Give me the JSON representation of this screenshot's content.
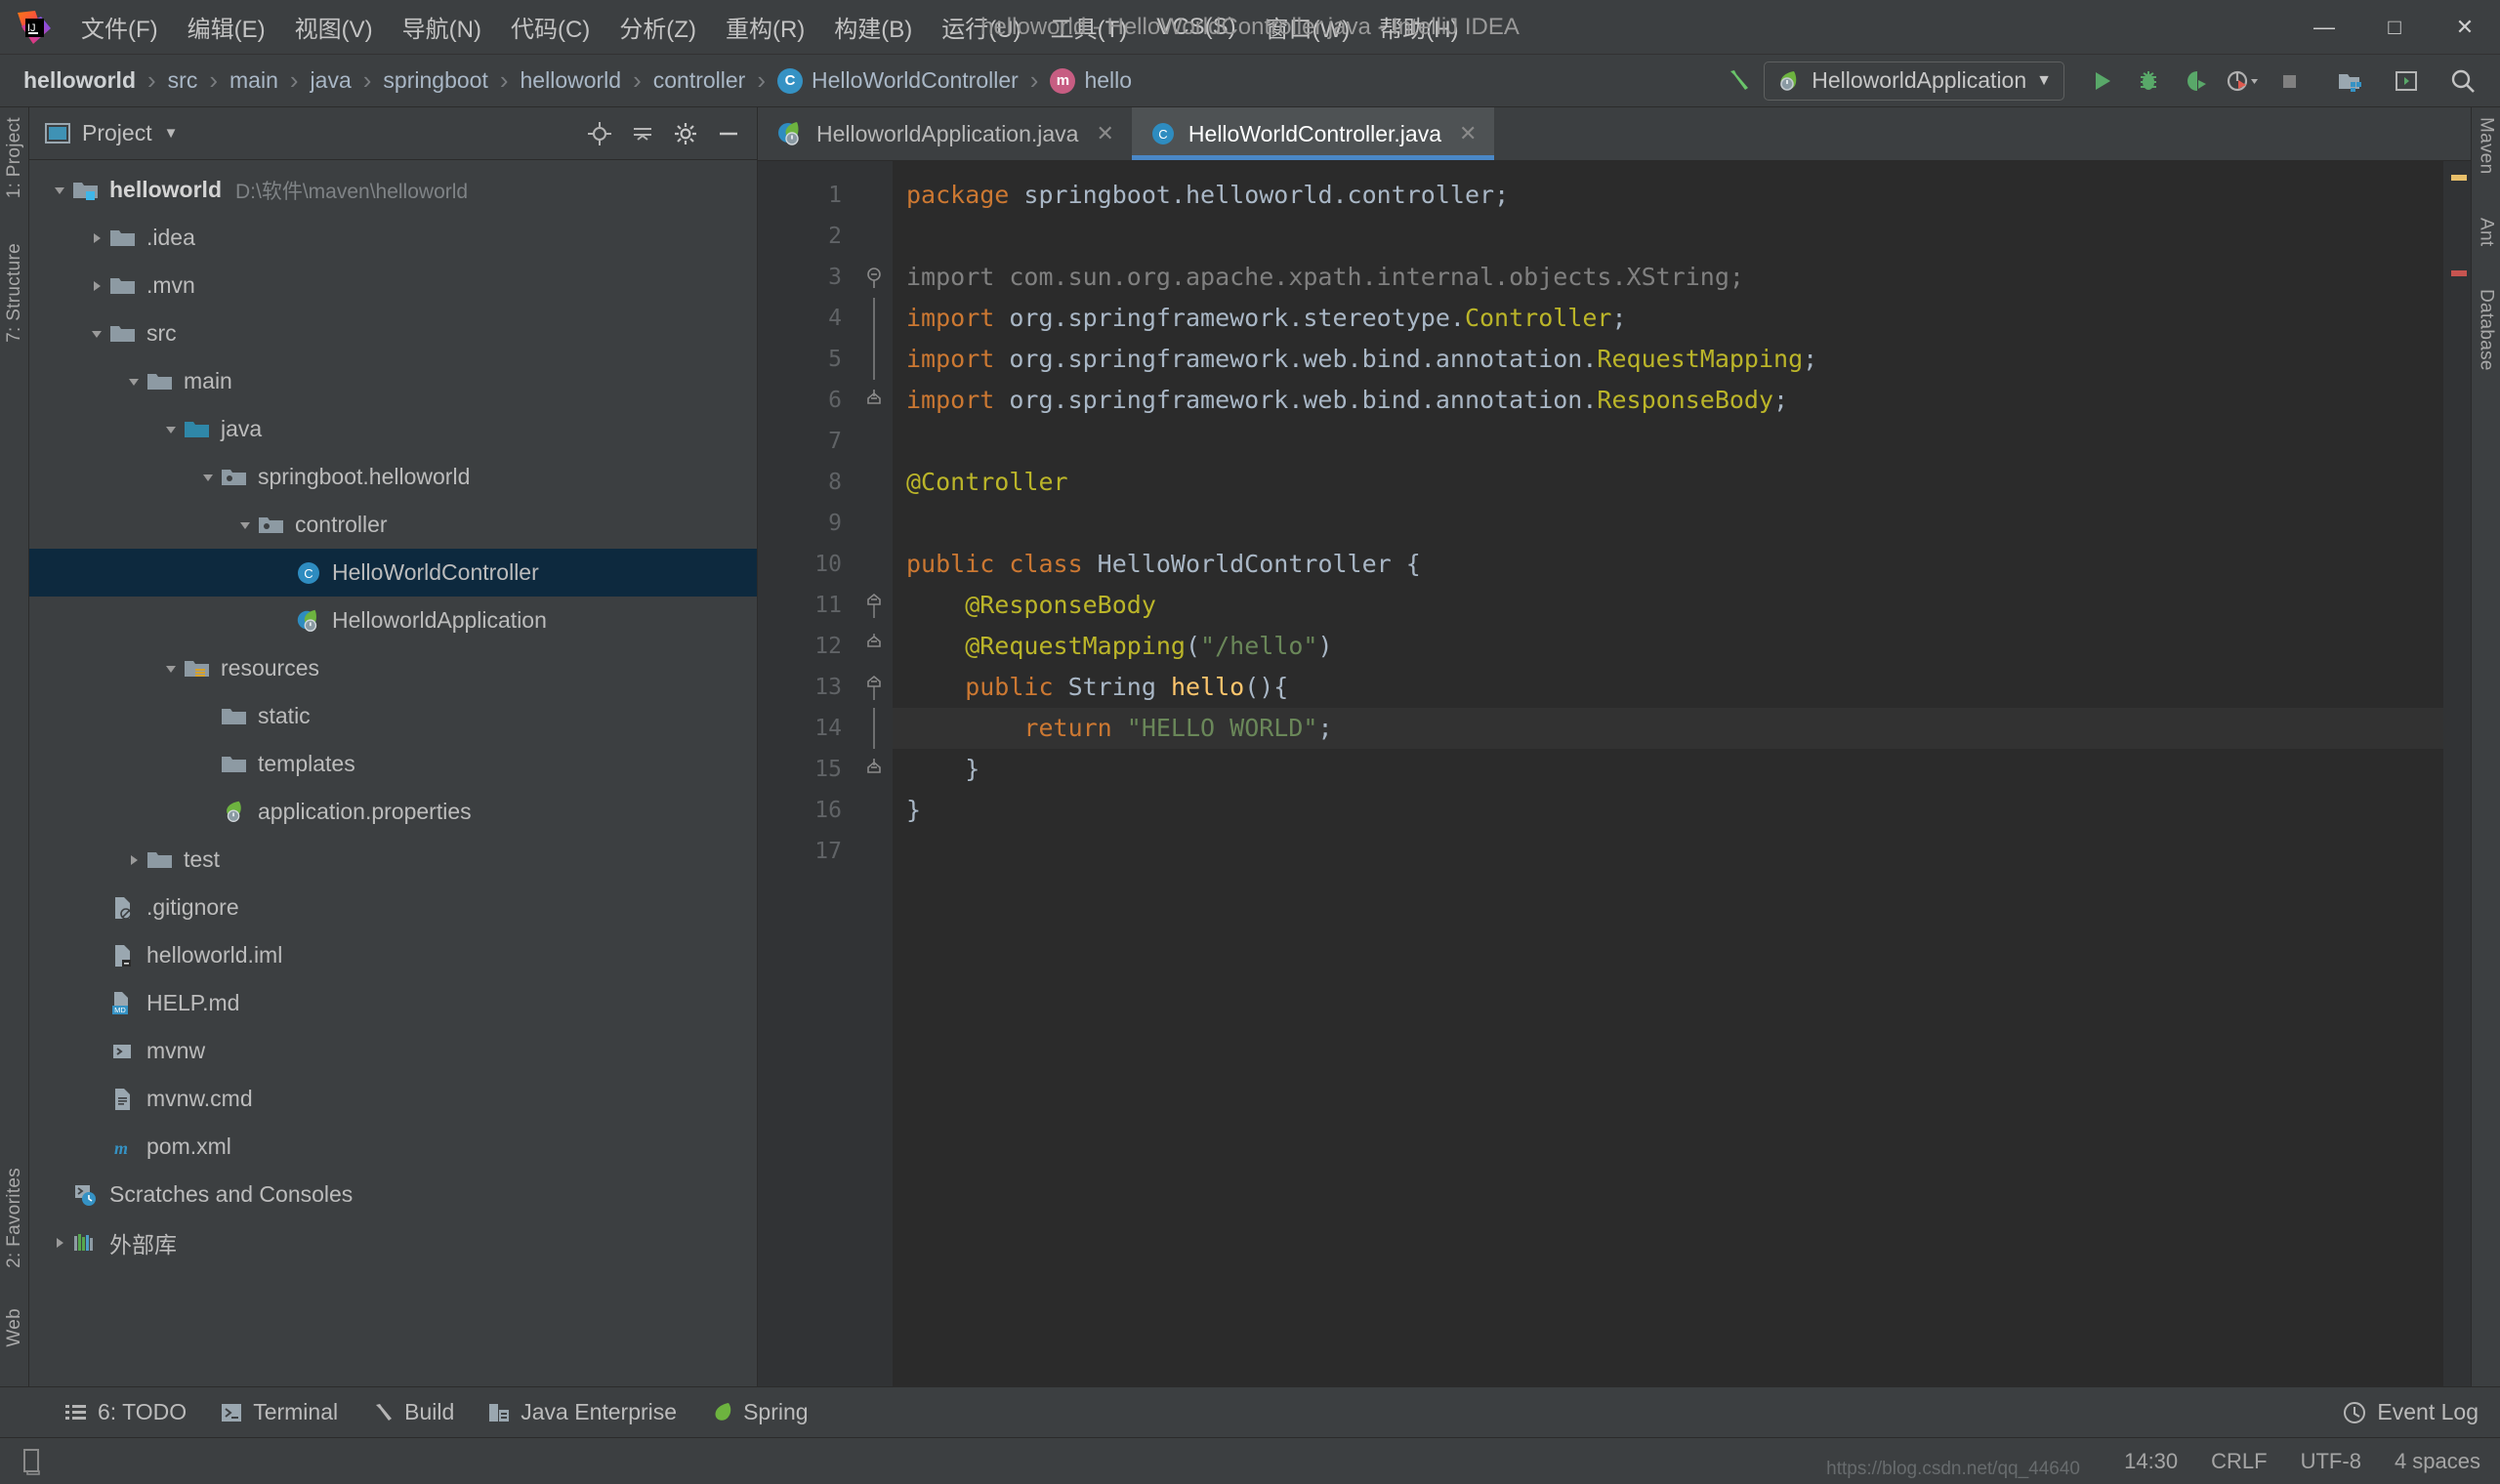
{
  "window": {
    "title": "helloworld - HelloWorldController.java - IntelliJ IDEA",
    "minimize": "—",
    "maximize": "□",
    "close": "✕"
  },
  "menubar": {
    "items": [
      {
        "label": "文件(F)"
      },
      {
        "label": "编辑(E)"
      },
      {
        "label": "视图(V)"
      },
      {
        "label": "导航(N)"
      },
      {
        "label": "代码(C)"
      },
      {
        "label": "分析(Z)"
      },
      {
        "label": "重构(R)"
      },
      {
        "label": "构建(B)"
      },
      {
        "label": "运行(U)"
      },
      {
        "label": "工具(T)"
      },
      {
        "label": "VCS(S)"
      },
      {
        "label": "窗口(W)"
      },
      {
        "label": "帮助(H)"
      }
    ]
  },
  "breadcrumb": {
    "separator": "›",
    "items": [
      {
        "label": "helloworld",
        "icon": "none",
        "bold": true
      },
      {
        "label": "src",
        "icon": "none",
        "bold": false
      },
      {
        "label": "main",
        "icon": "none",
        "bold": false
      },
      {
        "label": "java",
        "icon": "none",
        "bold": false
      },
      {
        "label": "springboot",
        "icon": "none",
        "bold": false
      },
      {
        "label": "helloworld",
        "icon": "none",
        "bold": false
      },
      {
        "label": "controller",
        "icon": "none",
        "bold": false
      },
      {
        "label": "HelloWorldController",
        "icon": "class-icon",
        "badge": "C",
        "bold": false
      },
      {
        "label": "hello",
        "icon": "method-icon",
        "badge": "m",
        "bold": false
      }
    ]
  },
  "toolbar": {
    "run_config": "HelloworldApplication",
    "run_config_dropdown": "▼",
    "buttons": [
      {
        "name": "build-hammer-icon",
        "title": "Build"
      },
      {
        "name": "run-icon",
        "title": "Run"
      },
      {
        "name": "debug-icon",
        "title": "Debug"
      },
      {
        "name": "run-coverage-icon",
        "title": "Run with Coverage"
      },
      {
        "name": "profiler-icon",
        "title": "Profiler"
      },
      {
        "name": "stop-icon",
        "title": "Stop"
      },
      {
        "name": "project-structure-icon",
        "title": "Project Structure"
      },
      {
        "name": "terminal-toggle-icon",
        "title": "Terminal"
      },
      {
        "name": "search-everywhere-icon",
        "title": "Search Everywhere"
      }
    ]
  },
  "left_strip": {
    "tabs": [
      {
        "label": "1: Project",
        "name": "sidebar-tab-project"
      },
      {
        "label": "7: Structure",
        "name": "sidebar-tab-structure"
      },
      {
        "label": "2: Favorites",
        "name": "sidebar-tab-favorites"
      },
      {
        "label": "Web",
        "name": "sidebar-tab-web"
      }
    ]
  },
  "right_strip": {
    "tabs": [
      {
        "label": "Maven",
        "name": "sidebar-tab-maven"
      },
      {
        "label": "Ant",
        "name": "sidebar-tab-ant"
      },
      {
        "label": "Database",
        "name": "sidebar-tab-database"
      }
    ]
  },
  "project_panel": {
    "title": "Project",
    "title_dropdown": "▼",
    "tree": [
      {
        "label": "helloworld",
        "path": "D:\\软件\\maven\\helloworld",
        "indent": 0,
        "twist": "down",
        "icon": "module-folder-icon",
        "bold": true,
        "selected": false
      },
      {
        "label": ".idea",
        "path": "",
        "indent": 1,
        "twist": "right",
        "icon": "folder-icon",
        "bold": false,
        "selected": false
      },
      {
        "label": ".mvn",
        "path": "",
        "indent": 1,
        "twist": "right",
        "icon": "folder-icon",
        "bold": false,
        "selected": false
      },
      {
        "label": "src",
        "path": "",
        "indent": 1,
        "twist": "down",
        "icon": "folder-icon",
        "bold": false,
        "selected": false
      },
      {
        "label": "main",
        "path": "",
        "indent": 2,
        "twist": "down",
        "icon": "folder-icon",
        "bold": false,
        "selected": false
      },
      {
        "label": "java",
        "path": "",
        "indent": 3,
        "twist": "down",
        "icon": "source-folder-icon",
        "bold": false,
        "selected": false
      },
      {
        "label": "springboot.helloworld",
        "path": "",
        "indent": 4,
        "twist": "down",
        "icon": "package-icon",
        "bold": false,
        "selected": false
      },
      {
        "label": "controller",
        "path": "",
        "indent": 5,
        "twist": "down",
        "icon": "package-icon",
        "bold": false,
        "selected": false
      },
      {
        "label": "HelloWorldController",
        "path": "",
        "indent": 6,
        "twist": "none",
        "icon": "java-class-icon",
        "bold": false,
        "selected": true
      },
      {
        "label": "HelloworldApplication",
        "path": "",
        "indent": 6,
        "twist": "none",
        "icon": "spring-boot-class-icon",
        "bold": false,
        "selected": false
      },
      {
        "label": "resources",
        "path": "",
        "indent": 3,
        "twist": "down",
        "icon": "resources-folder-icon",
        "bold": false,
        "selected": false
      },
      {
        "label": "static",
        "path": "",
        "indent": 4,
        "twist": "none",
        "icon": "folder-icon",
        "bold": false,
        "selected": false
      },
      {
        "label": "templates",
        "path": "",
        "indent": 4,
        "twist": "none",
        "icon": "folder-icon",
        "bold": false,
        "selected": false
      },
      {
        "label": "application.properties",
        "path": "",
        "indent": 4,
        "twist": "none",
        "icon": "spring-properties-icon",
        "bold": false,
        "selected": false
      },
      {
        "label": "test",
        "path": "",
        "indent": 2,
        "twist": "right",
        "icon": "folder-icon",
        "bold": false,
        "selected": false
      },
      {
        "label": ".gitignore",
        "path": "",
        "indent": 1,
        "twist": "none",
        "icon": "gitignore-file-icon",
        "bold": false,
        "selected": false
      },
      {
        "label": "helloworld.iml",
        "path": "",
        "indent": 1,
        "twist": "none",
        "icon": "iml-file-icon",
        "bold": false,
        "selected": false
      },
      {
        "label": "HELP.md",
        "path": "",
        "indent": 1,
        "twist": "none",
        "icon": "markdown-file-icon",
        "bold": false,
        "selected": false
      },
      {
        "label": "mvnw",
        "path": "",
        "indent": 1,
        "twist": "none",
        "icon": "shell-script-icon",
        "bold": false,
        "selected": false
      },
      {
        "label": "mvnw.cmd",
        "path": "",
        "indent": 1,
        "twist": "none",
        "icon": "cmd-file-icon",
        "bold": false,
        "selected": false
      },
      {
        "label": "pom.xml",
        "path": "",
        "indent": 1,
        "twist": "none",
        "icon": "maven-pom-icon",
        "bold": false,
        "selected": false
      },
      {
        "label": "Scratches and Consoles",
        "path": "",
        "indent": 0,
        "twist": "none",
        "icon": "scratches-icon",
        "bold": false,
        "selected": false
      },
      {
        "label": "外部库",
        "path": "",
        "indent": 0,
        "twist": "right",
        "icon": "external-libraries-icon",
        "bold": false,
        "selected": false
      }
    ]
  },
  "editor": {
    "tabs": [
      {
        "label": "HelloworldApplication.java",
        "icon": "spring-boot-class-icon",
        "active": false,
        "close": "✕"
      },
      {
        "label": "HelloWorldController.java",
        "icon": "java-class-icon",
        "active": true,
        "close": "✕"
      }
    ],
    "line_numbers": [
      "1",
      "2",
      "3",
      "4",
      "5",
      "6",
      "7",
      "8",
      "9",
      "10",
      "11",
      "12",
      "13",
      "14",
      "15",
      "16",
      "17"
    ],
    "current_line": 14,
    "lines": [
      {
        "n": 1,
        "tokens": [
          {
            "t": "package ",
            "c": "kw"
          },
          {
            "t": "springboot.helloworld.controller;",
            "c": "txt"
          }
        ]
      },
      {
        "n": 2,
        "tokens": []
      },
      {
        "n": 3,
        "tokens": [
          {
            "t": "import com.sun.org.apache.xpath.internal.objects.XString;",
            "c": "dim"
          }
        ]
      },
      {
        "n": 4,
        "tokens": [
          {
            "t": "import ",
            "c": "kw"
          },
          {
            "t": "org.springframework.stereotype.",
            "c": "txt"
          },
          {
            "t": "Controller",
            "c": "ann"
          },
          {
            "t": ";",
            "c": "txt"
          }
        ]
      },
      {
        "n": 5,
        "tokens": [
          {
            "t": "import ",
            "c": "kw"
          },
          {
            "t": "org.springframework.web.bind.annotation.",
            "c": "txt"
          },
          {
            "t": "RequestMapping",
            "c": "ann"
          },
          {
            "t": ";",
            "c": "txt"
          }
        ]
      },
      {
        "n": 6,
        "tokens": [
          {
            "t": "import ",
            "c": "kw"
          },
          {
            "t": "org.springframework.web.bind.annotation.",
            "c": "txt"
          },
          {
            "t": "ResponseBody",
            "c": "ann"
          },
          {
            "t": ";",
            "c": "txt"
          }
        ]
      },
      {
        "n": 7,
        "tokens": []
      },
      {
        "n": 8,
        "tokens": [
          {
            "t": "@Controller",
            "c": "ann"
          }
        ]
      },
      {
        "n": 9,
        "tokens": []
      },
      {
        "n": 10,
        "tokens": [
          {
            "t": "public class ",
            "c": "kw"
          },
          {
            "t": "HelloWorldController",
            "c": "txt"
          },
          {
            "t": " {",
            "c": "txt"
          }
        ]
      },
      {
        "n": 11,
        "tokens": [
          {
            "t": "    @ResponseBody",
            "c": "ann"
          }
        ]
      },
      {
        "n": 12,
        "tokens": [
          {
            "t": "    @RequestMapping",
            "c": "ann"
          },
          {
            "t": "(",
            "c": "txt"
          },
          {
            "t": "\"/hello\"",
            "c": "str"
          },
          {
            "t": ")",
            "c": "txt"
          }
        ]
      },
      {
        "n": 13,
        "tokens": [
          {
            "t": "    public ",
            "c": "kw"
          },
          {
            "t": "String ",
            "c": "txt"
          },
          {
            "t": "hello",
            "c": "mth"
          },
          {
            "t": "(){",
            "c": "txt"
          }
        ]
      },
      {
        "n": 14,
        "tokens": [
          {
            "t": "        return ",
            "c": "kw"
          },
          {
            "t": "\"HELLO WORLD\"",
            "c": "str"
          },
          {
            "t": ";",
            "c": "txt"
          }
        ]
      },
      {
        "n": 15,
        "tokens": [
          {
            "t": "    }",
            "c": "txt"
          }
        ]
      },
      {
        "n": 16,
        "tokens": [
          {
            "t": "}",
            "c": "txt"
          }
        ]
      },
      {
        "n": 17,
        "tokens": []
      }
    ],
    "gutter_marks": [
      {
        "line": 10,
        "icon": "spring-bean-gutter-icon"
      },
      {
        "line": 13,
        "icon": "spring-request-mapping-gutter-icon"
      }
    ],
    "fold_marks": [
      {
        "line": 3,
        "type": "fold-start"
      },
      {
        "line": 6,
        "type": "fold-end"
      },
      {
        "line": 11,
        "type": "fold-start"
      },
      {
        "line": 12,
        "type": "fold-collapse"
      },
      {
        "line": 13,
        "type": "fold-start"
      },
      {
        "line": 15,
        "type": "fold-end"
      }
    ],
    "marker_colors": {
      "warning": "#e8bf6a",
      "info": "#6a8759"
    }
  },
  "tool_window_bar": {
    "items": [
      {
        "label": "6: TODO",
        "underline": "6",
        "icon": "todo-icon",
        "name": "tool-window-todo"
      },
      {
        "label": "Terminal",
        "icon": "terminal-icon",
        "name": "tool-window-terminal"
      },
      {
        "label": "Build",
        "icon": "build-icon",
        "name": "tool-window-build"
      },
      {
        "label": "Java Enterprise",
        "icon": "java-enterprise-icon",
        "name": "tool-window-java-enterprise"
      },
      {
        "label": "Spring",
        "icon": "spring-icon",
        "name": "tool-window-spring"
      }
    ],
    "event_log": "Event Log"
  },
  "statusbar": {
    "time": "14:30",
    "line_separator": "CRLF",
    "encoding": "UTF-8",
    "indent": "4 spaces",
    "watermark": "https://blog.csdn.net/qq_44640"
  },
  "colors": {
    "accent": "#4a88c7",
    "selection": "#0d293e",
    "editor_bg": "#2b2b2b",
    "panel_bg": "#3c3f41",
    "gutter_bg": "#313335",
    "keyword": "#cc7832",
    "string": "#6a8759",
    "annotation": "#bbb529",
    "method": "#ffc66d",
    "text": "#a9b7c6",
    "class_badge": "#3592c4",
    "method_badge": "#c75d82",
    "spring_green": "#6db33f"
  }
}
